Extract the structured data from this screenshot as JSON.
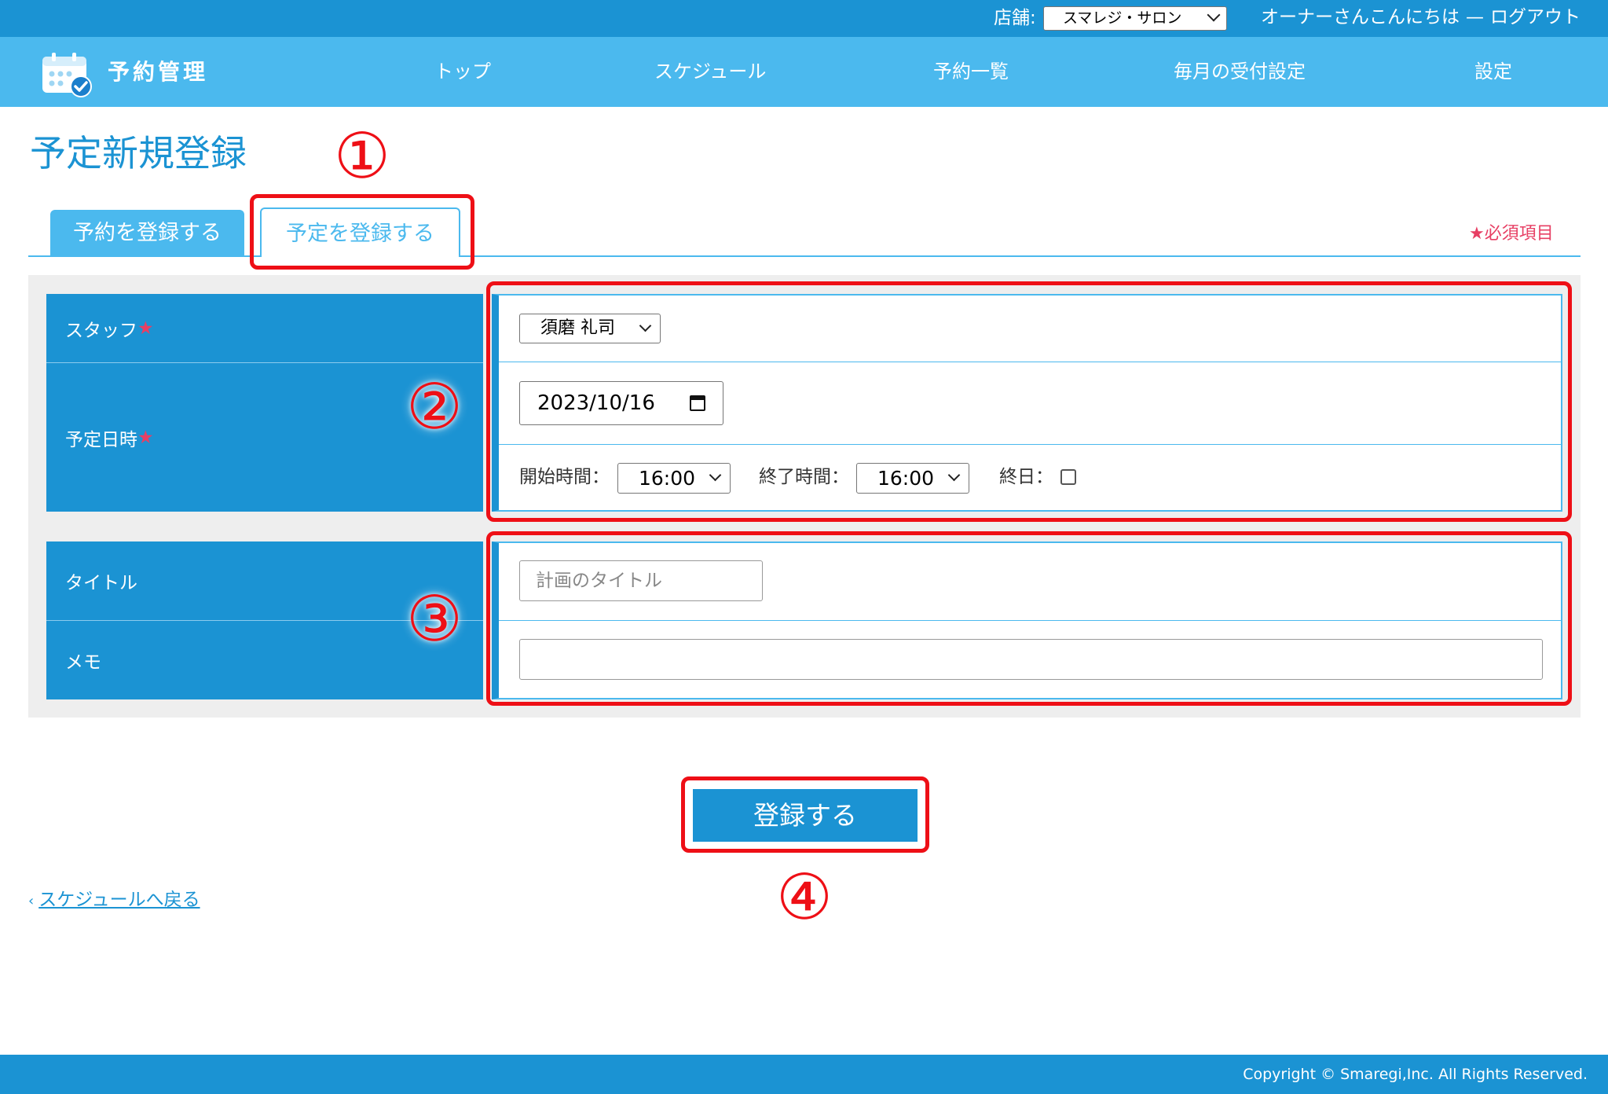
{
  "topbar": {
    "store_label": "店舗:",
    "store_value": "スマレジ・サロン",
    "greeting": "オーナーさんこんにちは",
    "separator": "—",
    "logout": "ログアウト"
  },
  "navbar": {
    "app_title": "予約管理",
    "logo_icon": "calendar-check-icon",
    "items": [
      "トップ",
      "スケジュール",
      "予約一覧",
      "毎月の受付設定",
      "設定"
    ]
  },
  "page": {
    "title": "予定新規登録",
    "tabs": [
      "予約を登録する",
      "予定を登録する"
    ],
    "active_tab": "予定を登録する",
    "required_note": "★必須項目"
  },
  "form": {
    "staff_label": "スタッフ",
    "staff_value": "須磨 礼司",
    "datetime_label": "予定日時",
    "date_value": "2023/10/16",
    "start_label": "開始時間：",
    "start_value": "16:00",
    "end_label": "終了時間：",
    "end_value": "16:00",
    "allday_label": "終日：",
    "allday_checked": false,
    "title_label": "タイトル",
    "title_placeholder": "計画のタイトル",
    "memo_label": "メモ",
    "memo_value": "",
    "required_mark": "★"
  },
  "actions": {
    "submit": "登録する",
    "back": "スケジュールへ戻る"
  },
  "footer": {
    "copyright": "Copyright © Smaregi,Inc. All Rights Reserved."
  },
  "annotations": [
    "①",
    "②",
    "③",
    "④"
  ],
  "colors": {
    "primary": "#1b93d3",
    "nav": "#4bb9ee",
    "required": "#e73f64",
    "annotation": "#ee0f16"
  }
}
